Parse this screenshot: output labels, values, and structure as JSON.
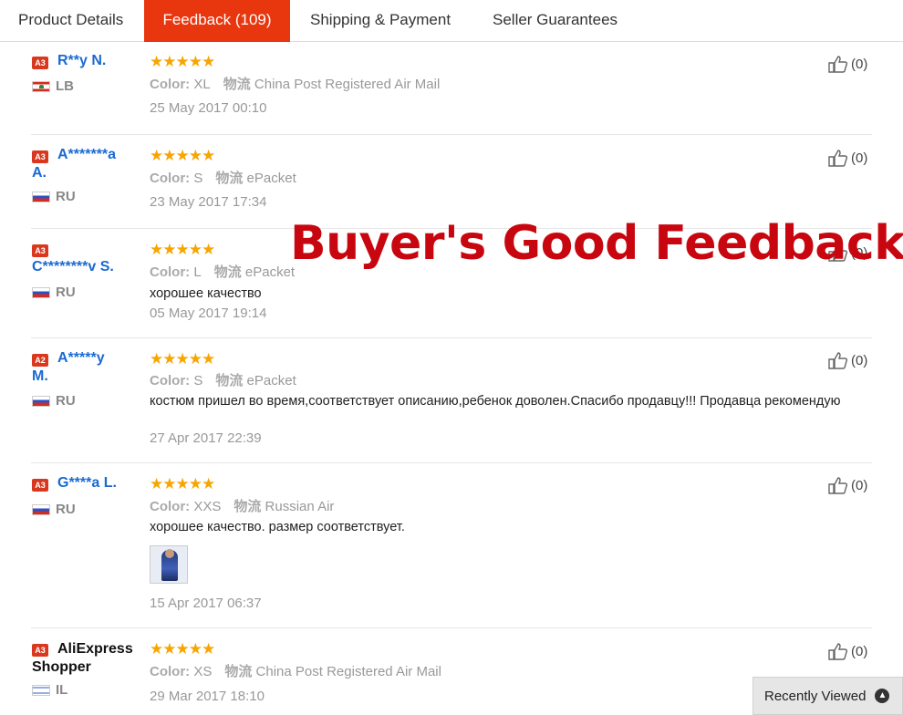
{
  "tabs": [
    {
      "label": "Product Details"
    },
    {
      "label": "Feedback (109)"
    },
    {
      "label": "Shipping & Payment"
    },
    {
      "label": "Seller Guarantees"
    }
  ],
  "headline": "Buyer's Good Feedback",
  "color_label": "Color:",
  "ship_label": "物流",
  "stars": "★★★★★",
  "feedback": [
    {
      "badge": "A3",
      "name1": "R**y N.",
      "name2": "",
      "country": "LB",
      "color": "XL",
      "ship": "China Post Registered Air Mail",
      "text": "",
      "date": "25 May 2017 00:10",
      "likes": "(0)"
    },
    {
      "badge": "A3",
      "name1": "A*******a",
      "name2": "A.",
      "country": "RU",
      "color": "S",
      "ship": "ePacket",
      "text": "",
      "date": "23 May 2017 17:34",
      "likes": "(0)"
    },
    {
      "badge": "A3",
      "name1": "",
      "name2": "C********v S.",
      "country": "RU",
      "color": "L",
      "ship": "ePacket",
      "text": "хорошее качество",
      "date": "05 May 2017 19:14",
      "likes": "(0)"
    },
    {
      "badge": "A2",
      "name1": "A*****y",
      "name2": "M.",
      "country": "RU",
      "color": "S",
      "ship": "ePacket",
      "text": "костюм пришел во время,соответствует описанию,ребенок доволен.Спасибо продавцу!!! Продавца рекомендую",
      "date": "27 Apr 2017 22:39",
      "likes": "(0)"
    },
    {
      "badge": "A3",
      "name1": "G****a L.",
      "name2": "",
      "country": "RU",
      "color": "XXS",
      "ship": "Russian Air",
      "text": "хорошее качество. размер соответствует.",
      "date": "15 Apr 2017 06:37",
      "likes": "(0)"
    },
    {
      "badge": "A3",
      "name1": "AliExpress",
      "name2": "Shopper",
      "country": "IL",
      "color": "XS",
      "ship": "China Post Registered Air Mail",
      "text": "",
      "date": "29 Mar 2017 18:10",
      "likes": "(0)"
    }
  ],
  "recent": {
    "label": "Recently Viewed"
  }
}
